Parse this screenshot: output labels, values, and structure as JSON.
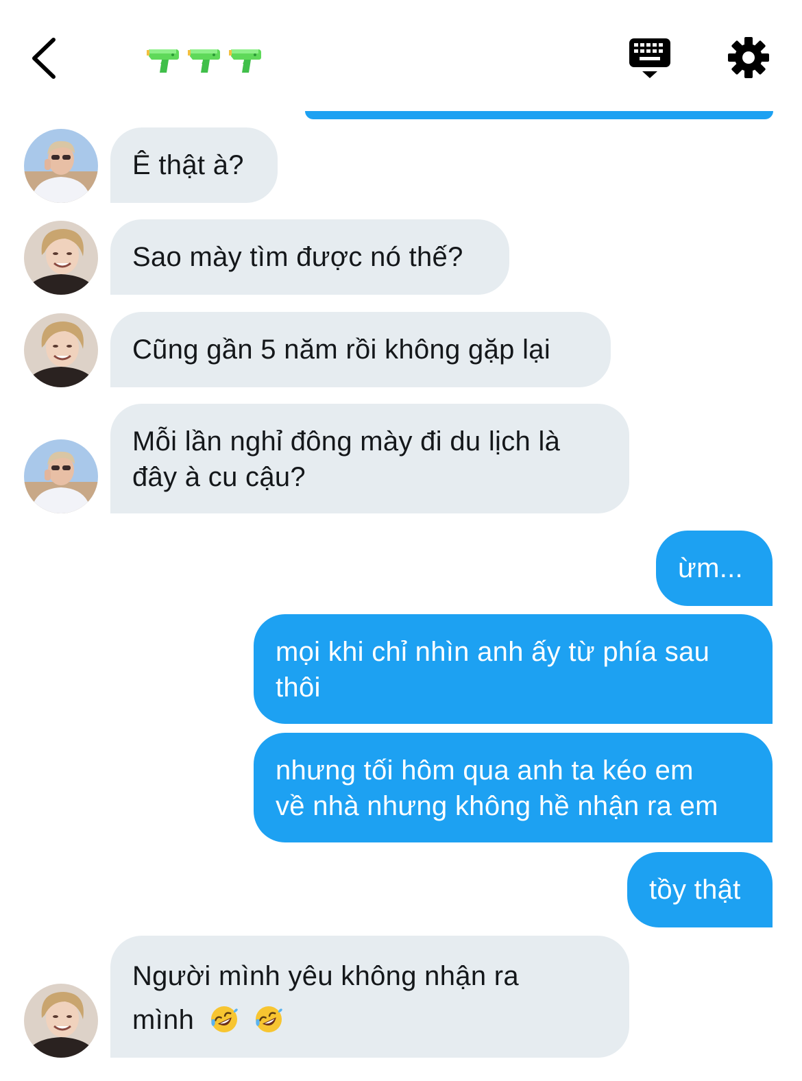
{
  "header": {
    "title_emojis": [
      "water-pistol",
      "water-pistol",
      "water-pistol"
    ],
    "back_icon": "chevron-left-icon",
    "keyboard_icon": "keyboard-icon",
    "settings_icon": "gear-icon"
  },
  "colors": {
    "outgoing_bubble": "#1da1f2",
    "incoming_bubble": "#e6ecf0",
    "incoming_text": "#14171a",
    "outgoing_text": "#ffffff"
  },
  "messages": [
    {
      "sender": "them",
      "avatar": "avatar-a",
      "lines": [
        "Ê thật à?"
      ]
    },
    {
      "sender": "them",
      "avatar": "avatar-b",
      "lines": [
        "Sao mày tìm được nó thế?"
      ]
    },
    {
      "sender": "them",
      "avatar": "avatar-b",
      "lines": [
        "Cũng gần 5 năm rồi không gặp lại"
      ]
    },
    {
      "sender": "them",
      "avatar": "avatar-a",
      "lines": [
        "Mỗi lần nghỉ đông mày đi du lịch là",
        "đây à cu cậu?"
      ]
    },
    {
      "sender": "me",
      "lines": [
        "ừm..."
      ]
    },
    {
      "sender": "me",
      "lines": [
        "mọi khi chỉ nhìn anh ấy từ phía sau",
        "thôi"
      ]
    },
    {
      "sender": "me",
      "lines": [
        "nhưng tối hôm qua anh ta kéo em",
        "về nhà nhưng không hề nhận ra em"
      ]
    },
    {
      "sender": "me",
      "lines": [
        "tồy thật"
      ]
    },
    {
      "sender": "them",
      "avatar": "avatar-b",
      "lines": [
        "Người mình yêu không nhận ra",
        "mình"
      ],
      "emojis": [
        "rolling-on-floor-laughing",
        "rolling-on-floor-laughing"
      ]
    }
  ]
}
